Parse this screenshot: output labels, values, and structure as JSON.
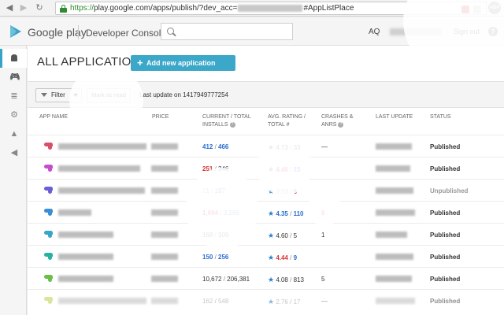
{
  "browser": {
    "url_scheme": "https://",
    "url_host_path": "play.google.com/apps/publish/?dev_acc=",
    "url_hash": "#AppListPlace",
    "abp_label": "ABP"
  },
  "header": {
    "brand": "Google play",
    "product": "Developer Console",
    "user_initials": "AQ",
    "sign_out": "Sign out"
  },
  "page": {
    "title": "ALL APPLICATIONS",
    "add_button": "Add new application",
    "filter_button": "Filter",
    "mark_read_button": "Mark as read",
    "last_update": "Last update on 1417949777254"
  },
  "columns": {
    "app_name": "APP NAME",
    "price": "PRICE",
    "installs_l1": "CURRENT / TOTAL",
    "installs_l2": "INSTALLS",
    "rating_l1": "AVG. RATING /",
    "rating_l2": "TOTAL #",
    "crashes_l1": "CRASHES &",
    "crashes_l2": "ANRS",
    "last_update": "LAST UPDATE",
    "status": "STATUS"
  },
  "rows": [
    {
      "current": "412",
      "total": "466",
      "rating": "4.73",
      "ratings": "33",
      "crashes": "—",
      "status": "Published"
    },
    {
      "current": "251",
      "total": "346",
      "rating": "4.40",
      "ratings": "15",
      "crashes": "",
      "status": "Published"
    },
    {
      "current": "21",
      "total": "187",
      "rating": "3.50",
      "ratings": "6",
      "crashes": "",
      "status": "Unpublished"
    },
    {
      "current": "1,694",
      "total": "3,269",
      "rating": "4.35",
      "ratings": "110",
      "crashes": "8",
      "status": "Published"
    },
    {
      "current": "168",
      "total": "309",
      "rating": "4.60",
      "ratings": "5",
      "crashes": "1",
      "status": "Published"
    },
    {
      "current": "150",
      "total": "256",
      "rating": "4.44",
      "ratings": "9",
      "crashes": "",
      "status": "Published"
    },
    {
      "current": "10,672",
      "total": "206,381",
      "rating": "4.08",
      "ratings": "813",
      "crashes": "5",
      "status": "Published"
    },
    {
      "current": "162",
      "total": "548",
      "rating": "2.76",
      "ratings": "17",
      "crashes": "—",
      "status": "Published"
    }
  ],
  "icons": {
    "back": "back-arrow-icon",
    "forward": "forward-arrow-icon",
    "reload": "reload-icon",
    "lock": "lock-icon",
    "search": "search-icon",
    "help": "help-icon",
    "logo": "google-play-logo-icon",
    "android": "android-icon",
    "gamepad": "gamepad-icon",
    "settings": "gear-icon",
    "alerts": "warning-icon",
    "announcements": "megaphone-icon"
  },
  "colors": {
    "accent": "#3ba8c9",
    "link_blue": "#2a6fcf",
    "alert_red": "#d63333"
  }
}
